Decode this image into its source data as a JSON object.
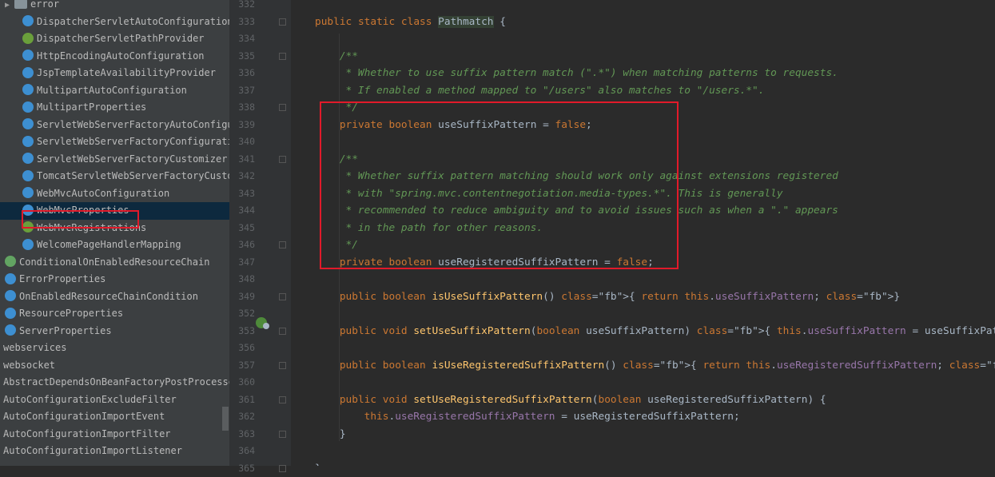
{
  "tree": {
    "items": [
      {
        "label": "error",
        "icon": "folder-icon",
        "indent": 1,
        "arrow": "▶"
      },
      {
        "label": "DispatcherServletAutoConfiguration",
        "icon": "class-icon",
        "indent": 2
      },
      {
        "label": "DispatcherServletPathProvider",
        "icon": "interface-icon",
        "indent": 2
      },
      {
        "label": "HttpEncodingAutoConfiguration",
        "icon": "class-icon",
        "indent": 2
      },
      {
        "label": "JspTemplateAvailabilityProvider",
        "icon": "class-icon",
        "indent": 2
      },
      {
        "label": "MultipartAutoConfiguration",
        "icon": "class-icon",
        "indent": 2
      },
      {
        "label": "MultipartProperties",
        "icon": "class-icon",
        "indent": 2
      },
      {
        "label": "ServletWebServerFactoryAutoConfiguration",
        "icon": "class-icon",
        "indent": 2
      },
      {
        "label": "ServletWebServerFactoryConfiguration",
        "icon": "class-icon",
        "indent": 2
      },
      {
        "label": "ServletWebServerFactoryCustomizer",
        "icon": "class-icon",
        "indent": 2
      },
      {
        "label": "TomcatServletWebServerFactoryCustomizer",
        "icon": "class-icon",
        "indent": 2
      },
      {
        "label": "WebMvcAutoConfiguration",
        "icon": "class-icon",
        "indent": 2
      },
      {
        "label": "WebMvcProperties",
        "icon": "class-icon",
        "indent": 2,
        "selected": true
      },
      {
        "label": "WebMvcRegistrations",
        "icon": "interface-icon",
        "indent": 2
      },
      {
        "label": "WelcomePageHandlerMapping",
        "icon": "class-icon",
        "indent": 2
      },
      {
        "label": "ConditionalOnEnabledResourceChain",
        "icon": "annotation-icon",
        "indent": 0
      },
      {
        "label": "ErrorProperties",
        "icon": "class-icon",
        "indent": 0
      },
      {
        "label": "OnEnabledResourceChainCondition",
        "icon": "class-icon",
        "indent": 0
      },
      {
        "label": "ResourceProperties",
        "icon": "class-icon",
        "indent": 0
      },
      {
        "label": "ServerProperties",
        "icon": "class-icon",
        "indent": 0
      },
      {
        "label": "webservices",
        "icon": "",
        "indent": -1
      },
      {
        "label": "websocket",
        "icon": "",
        "indent": -1
      },
      {
        "label": "AbstractDependsOnBeanFactoryPostProcessor",
        "icon": "",
        "indent": -1
      },
      {
        "label": "AutoConfigurationExcludeFilter",
        "icon": "",
        "indent": -1
      },
      {
        "label": "AutoConfigurationImportEvent",
        "icon": "",
        "indent": -1
      },
      {
        "label": "AutoConfigurationImportFilter",
        "icon": "",
        "indent": -1
      },
      {
        "label": "AutoConfigurationImportListener",
        "icon": "",
        "indent": -1
      }
    ]
  },
  "gutter": {
    "line_numbers": [
      "332",
      "333",
      "334",
      "335",
      "336",
      "337",
      "338",
      "339",
      "340",
      "341",
      "342",
      "343",
      "344",
      "345",
      "346",
      "347",
      "348",
      "349",
      "352",
      "353",
      "356",
      "357",
      "360",
      "361",
      "362",
      "363",
      "364",
      "365"
    ]
  },
  "code": {
    "lines": [
      "",
      "public static class Pathmatch {",
      "",
      "    /**",
      "     * Whether to use suffix pattern match (\".*\") when matching patterns to requests.",
      "     * If enabled a method mapped to \"/users\" also matches to \"/users.*\".",
      "     */",
      "    private boolean useSuffixPattern = false;",
      "",
      "    /**",
      "     * Whether suffix pattern matching should work only against extensions registered",
      "     * with \"spring.mvc.contentnegotiation.media-types.*\". This is generally",
      "     * recommended to reduce ambiguity and to avoid issues such as when a \".\" appears",
      "     * in the path for other reasons.",
      "     */",
      "    private boolean useRegisteredSuffixPattern = false;",
      "",
      "    public boolean isUseSuffixPattern() { return this.useSuffixPattern; }",
      "",
      "    public void setUseSuffixPattern(boolean useSuffixPattern) { this.useSuffixPattern = useSuffixPattern; }",
      "",
      "    public boolean isUseRegisteredSuffixPattern() { return this.useRegisteredSuffixPattern; }",
      "",
      "    public void setUseRegisteredSuffixPattern(boolean useRegisteredSuffixPattern) {",
      "        this.useRegisteredSuffixPattern = useRegisteredSuffixPattern;",
      "    }",
      "",
      "}"
    ]
  },
  "colors": {
    "keyword": "#cc7832",
    "comment": "#629755",
    "field": "#9876aa",
    "method": "#ffc66d",
    "highlight_box": "#e11a2a"
  }
}
